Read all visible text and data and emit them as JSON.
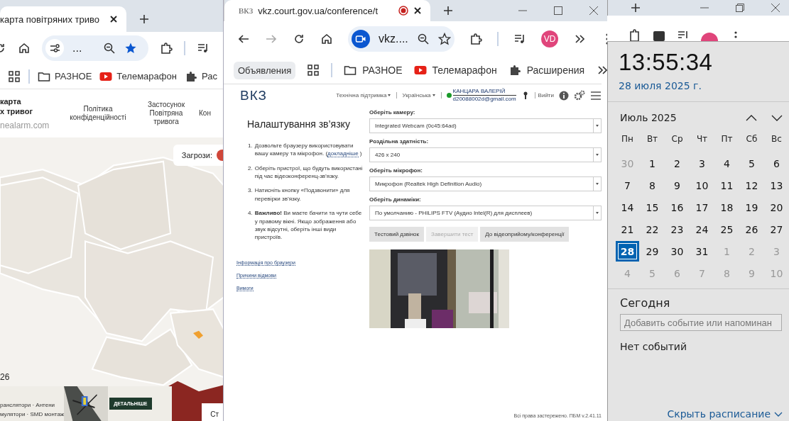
{
  "left_window": {
    "tab": {
      "title": "карта повітряних триво"
    },
    "address": {
      "text": "..."
    },
    "bookmarks": [
      {
        "kind": "apps"
      },
      {
        "kind": "folder",
        "label": "РАЗНОЕ"
      },
      {
        "kind": "video",
        "label": "Телемарафон"
      },
      {
        "kind": "extension",
        "label": "Рас"
      }
    ],
    "site": {
      "title_lines": [
        "карта",
        "х тривог"
      ],
      "domain": "nealarm.com",
      "nav": [
        "Політика конфіденційності",
        "Застосунок Повітряна тривога",
        "Кон"
      ]
    },
    "map": {
      "kind": "picture",
      "threats_label": "Загрози:",
      "count": "26",
      "corner_label": "Ст"
    },
    "ad": {
      "lines": [
        "ранслятори · Антени",
        "мулятори · SMD монтаж"
      ],
      "button": "ДЕТАЛЬНІШЕ"
    }
  },
  "middle_window": {
    "tab": {
      "favicon": "ВКЗ",
      "title": "vkz.court.gov.ua/conference/t",
      "recording": true
    },
    "toolbar": {
      "forward_disabled": true,
      "address": "vkz....",
      "avatar": "VD"
    },
    "bookmarks": [
      {
        "kind": "chip",
        "label": "Объявления"
      },
      {
        "kind": "apps"
      },
      {
        "kind": "folder",
        "label": "РАЗНОЕ"
      },
      {
        "kind": "video",
        "label": "Телемарафон"
      },
      {
        "kind": "extension",
        "label": "Расширения"
      }
    ],
    "page": {
      "logo": "ВКЗ",
      "menus": [
        "Технічна підтримка",
        "Українська"
      ],
      "user": {
        "name": "КАНЦАРА ВАЛЕРІЙ",
        "email": "d20088002d@gmail.com",
        "online": true
      },
      "logout": "Вийти",
      "settings": {
        "title": "Налаштування зв’язку",
        "steps": [
          {
            "number": "1.",
            "text": "Дозвольте браузеру використовувати вашу камеру та мікрофон. (",
            "link": "докладніше",
            "tail": ")"
          },
          {
            "number": "2.",
            "text": "Оберіть пристрої, що будуть використані під час відеоконференц-зв’язку."
          },
          {
            "number": "3.",
            "text": "Натисніть кнопку «Подзвонити» для перевірки зв’язку."
          },
          {
            "number": "4.",
            "text": "**Важливо!** Ви маєте бачити та чути себе у правому вікні. Якщо зображення або звук відсутні, оберіть інші види пристроїв."
          }
        ],
        "links": [
          "Інформація про браузери",
          "Причини відмови",
          "Вимоги"
        ],
        "fields": [
          {
            "label": "Оберіть камеру:",
            "value": "Integrated Webcam (0c45:64ad)"
          },
          {
            "label": "Роздільна здатність:",
            "value": "426 x 240"
          },
          {
            "label": "Оберіть мікрофон:",
            "value": "Микрофон (Realtek High Definition Audio)"
          },
          {
            "label": "Оберіть динаміки:",
            "value": "По умолчанию - PHILIPS FTV (Аудио Intel(R) для дисплеев)"
          }
        ],
        "buttons": [
          {
            "label": "Тестовий дзвінок",
            "disabled": false
          },
          {
            "label": "Завершити тест",
            "disabled": true
          },
          {
            "label": "До відеоприйому/конференції",
            "disabled": false
          }
        ],
        "preview": {
          "kind": "picture"
        }
      },
      "footer": "Всі права застережено. ПБМ v.2.41.11"
    }
  },
  "calendar": {
    "time": "13:55:34",
    "date": "28 июля 2025 г.",
    "month": "Июль 2025",
    "weekdays": [
      "Пн",
      "Вт",
      "Ср",
      "Чт",
      "Пт",
      "Сб",
      "Вс"
    ],
    "days": [
      {
        "label": "30",
        "in_month": false,
        "selected": false
      },
      {
        "label": "1",
        "in_month": true,
        "selected": false
      },
      {
        "label": "2",
        "in_month": true,
        "selected": false
      },
      {
        "label": "3",
        "in_month": true,
        "selected": false
      },
      {
        "label": "4",
        "in_month": true,
        "selected": false
      },
      {
        "label": "5",
        "in_month": true,
        "selected": false
      },
      {
        "label": "6",
        "in_month": true,
        "selected": false
      },
      {
        "label": "7",
        "in_month": true,
        "selected": false
      },
      {
        "label": "8",
        "in_month": true,
        "selected": false
      },
      {
        "label": "9",
        "in_month": true,
        "selected": false
      },
      {
        "label": "10",
        "in_month": true,
        "selected": false
      },
      {
        "label": "11",
        "in_month": true,
        "selected": false
      },
      {
        "label": "12",
        "in_month": true,
        "selected": false
      },
      {
        "label": "13",
        "in_month": true,
        "selected": false
      },
      {
        "label": "14",
        "in_month": true,
        "selected": false
      },
      {
        "label": "15",
        "in_month": true,
        "selected": false
      },
      {
        "label": "16",
        "in_month": true,
        "selected": false
      },
      {
        "label": "17",
        "in_month": true,
        "selected": false
      },
      {
        "label": "18",
        "in_month": true,
        "selected": false
      },
      {
        "label": "19",
        "in_month": true,
        "selected": false
      },
      {
        "label": "20",
        "in_month": true,
        "selected": false
      },
      {
        "label": "21",
        "in_month": true,
        "selected": false
      },
      {
        "label": "22",
        "in_month": true,
        "selected": false
      },
      {
        "label": "23",
        "in_month": true,
        "selected": false
      },
      {
        "label": "24",
        "in_month": true,
        "selected": false
      },
      {
        "label": "25",
        "in_month": true,
        "selected": false
      },
      {
        "label": "26",
        "in_month": true,
        "selected": false
      },
      {
        "label": "27",
        "in_month": true,
        "selected": false
      },
      {
        "label": "28",
        "in_month": true,
        "selected": true
      },
      {
        "label": "29",
        "in_month": true,
        "selected": false
      },
      {
        "label": "30",
        "in_month": true,
        "selected": false
      },
      {
        "label": "31",
        "in_month": true,
        "selected": false
      },
      {
        "label": "1",
        "in_month": false,
        "selected": false
      },
      {
        "label": "2",
        "in_month": false,
        "selected": false
      },
      {
        "label": "3",
        "in_month": false,
        "selected": false
      },
      {
        "label": "4",
        "in_month": false,
        "selected": false
      },
      {
        "label": "5",
        "in_month": false,
        "selected": false
      },
      {
        "label": "6",
        "in_month": false,
        "selected": false
      },
      {
        "label": "7",
        "in_month": false,
        "selected": false
      },
      {
        "label": "8",
        "in_month": false,
        "selected": false
      },
      {
        "label": "9",
        "in_month": false,
        "selected": false
      },
      {
        "label": "10",
        "in_month": false,
        "selected": false
      }
    ],
    "today": {
      "title": "Сегодня",
      "placeholder": "Добавить событие или напоминан",
      "empty": "Нет событий"
    },
    "hide_link": "Скрыть расписание"
  }
}
